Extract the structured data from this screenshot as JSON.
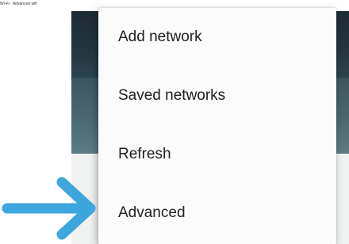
{
  "caption": {
    "text": "Wi-Fi · Advanced wifi"
  },
  "menu": {
    "items": [
      {
        "label": "Add network"
      },
      {
        "label": "Saved networks"
      },
      {
        "label": "Refresh"
      },
      {
        "label": "Advanced"
      }
    ]
  },
  "annotation": {
    "icon": "right-arrow-icon",
    "color": "#3da6dd",
    "points_to": "Advanced"
  },
  "colors": {
    "toolbar": "#22333c",
    "subbar": "#4d6b75",
    "menu_background": "#fbfbfb",
    "menu_text": "#202020",
    "arrow": "#3da6dd"
  }
}
